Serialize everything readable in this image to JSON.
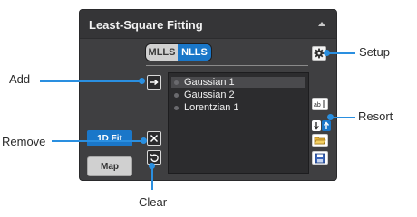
{
  "panel": {
    "title": "Least-Square Fitting",
    "collapse_icon": "chevron-up-icon"
  },
  "mode_toggle": {
    "options": [
      "MLLS",
      "NLLS"
    ],
    "selected": "NLLS"
  },
  "fit_list": {
    "items": [
      {
        "label": "Gaussian 1",
        "selected": true
      },
      {
        "label": "Gaussian 2",
        "selected": false
      },
      {
        "label": "Lorentzian 1",
        "selected": false
      }
    ]
  },
  "buttons": {
    "fit_1d": "1D Fit",
    "map": "Map"
  },
  "icons": {
    "setup": "gear-icon",
    "add": "arrow-right-icon",
    "remove": "close-icon",
    "clear": "undo-icon",
    "sort_alpha": "sort-alpha-icon",
    "sort_down": "arrow-down-icon",
    "sort_up": "arrow-up-icon",
    "open": "folder-open-icon",
    "save": "save-icon"
  },
  "callouts": {
    "add": "Add",
    "remove": "Remove",
    "clear": "Clear",
    "setup": "Setup",
    "resort": "Resort"
  },
  "colors": {
    "accent": "#1a77c9",
    "callout": "#2a8fe0",
    "panel_bg": "#3f3f41"
  }
}
